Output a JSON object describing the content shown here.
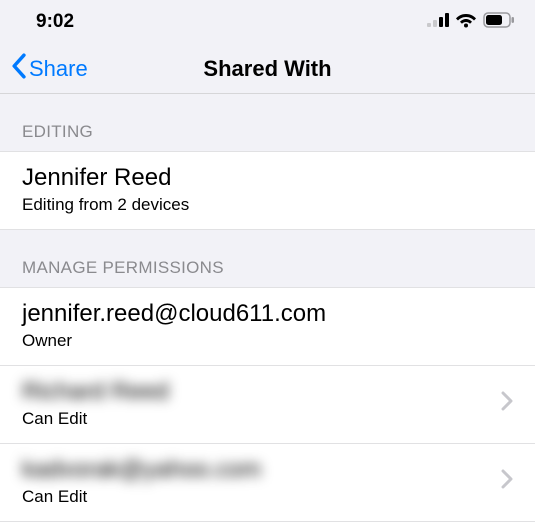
{
  "status_bar": {
    "time": "9:02"
  },
  "nav": {
    "back_label": "Share",
    "title": "Shared With"
  },
  "sections": {
    "editing": {
      "header": "EDITING",
      "name": "Jennifer Reed",
      "subtitle": "Editing from 2 devices"
    },
    "manage": {
      "header": "MANAGE PERMISSIONS",
      "items": [
        {
          "label": "jennifer.reed@cloud611.com",
          "role": "Owner",
          "blurred": false,
          "disclosure": false
        },
        {
          "label": "Richard Reed",
          "role": "Can Edit",
          "blurred": true,
          "disclosure": true
        },
        {
          "label": "kadvorak@yahoo.com",
          "role": "Can Edit",
          "blurred": true,
          "disclosure": true
        }
      ]
    }
  }
}
